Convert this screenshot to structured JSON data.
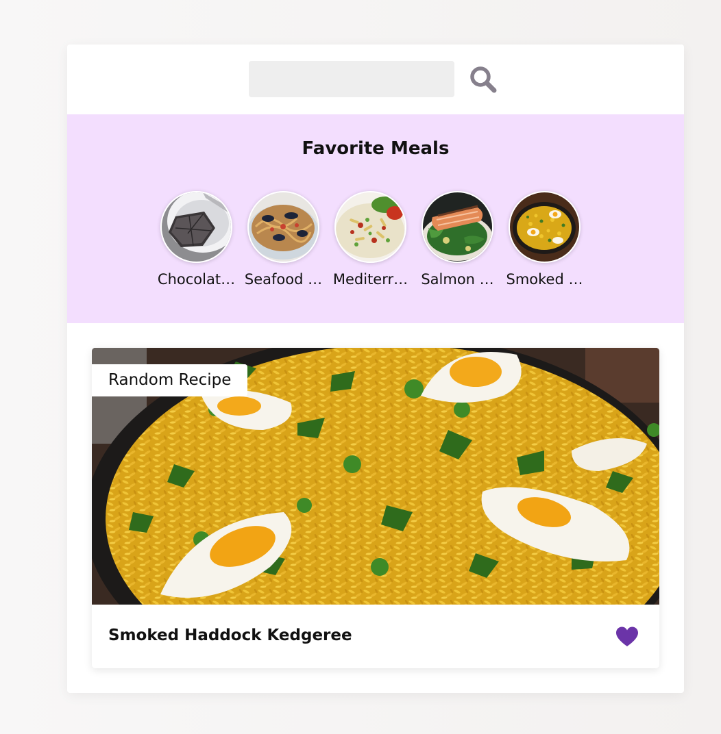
{
  "search": {
    "placeholder": "",
    "value": ""
  },
  "favorites": {
    "title": "Favorite Meals",
    "items": [
      {
        "label": "Chocolat…",
        "icon": "chocolate-cake-image"
      },
      {
        "label": "Seafood …",
        "icon": "seafood-pasta-image"
      },
      {
        "label": "Mediterr…",
        "icon": "mediterranean-salad-image"
      },
      {
        "label": "Salmon …",
        "icon": "salmon-salad-image"
      },
      {
        "label": "Smoked …",
        "icon": "smoked-haddock-image"
      }
    ]
  },
  "random_meal": {
    "badge": "Random Recipe",
    "title": "Smoked Haddock Kedgeree",
    "favorite_active": true
  },
  "colors": {
    "background": "#f5f4f3",
    "favorites_bg": "#f3defe",
    "search_field": "#eeeeee",
    "search_icon": "#86808c",
    "heart": "#6b34a8"
  },
  "icons": {
    "search": "search-icon",
    "heart": "heart-icon"
  }
}
